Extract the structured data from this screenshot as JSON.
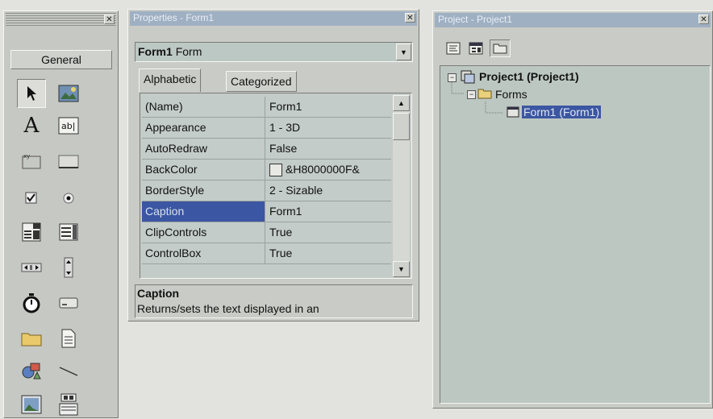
{
  "toolbox": {
    "title": "",
    "tab_label": "General",
    "tools": [
      {
        "icon": "pointer-icon"
      },
      {
        "icon": "picturebox-icon"
      },
      {
        "icon": "label-icon"
      },
      {
        "icon": "textbox-icon"
      },
      {
        "icon": "frame-icon"
      },
      {
        "icon": "commandbutton-icon"
      },
      {
        "icon": "checkbox-icon"
      },
      {
        "icon": "optionbutton-icon"
      },
      {
        "icon": "combobox-icon"
      },
      {
        "icon": "listbox-icon"
      },
      {
        "icon": "hscrollbar-icon"
      },
      {
        "icon": "vscrollbar-icon"
      },
      {
        "icon": "timer-icon"
      },
      {
        "icon": "drivelistbox-icon"
      },
      {
        "icon": "dirlistbox-icon"
      },
      {
        "icon": "filelistbox-icon"
      },
      {
        "icon": "shape-icon"
      },
      {
        "icon": "line-icon"
      },
      {
        "icon": "image-icon"
      },
      {
        "icon": "data-icon"
      }
    ]
  },
  "properties": {
    "title": "Properties - Form1",
    "object_name": "Form1",
    "object_type": "Form",
    "tabs": [
      {
        "label": "Alphabetic",
        "active": true
      },
      {
        "label": "Categorized",
        "active": false
      }
    ],
    "rows": [
      {
        "name": "(Name)",
        "value": "Form1"
      },
      {
        "name": "Appearance",
        "value": "1 - 3D"
      },
      {
        "name": "AutoRedraw",
        "value": "False"
      },
      {
        "name": "BackColor",
        "value": "&H8000000F&"
      },
      {
        "name": "BorderStyle",
        "value": "2 - Sizable"
      },
      {
        "name": "Caption",
        "value": "Form1",
        "selected": true
      },
      {
        "name": "ClipControls",
        "value": "True"
      },
      {
        "name": "ControlBox",
        "value": "True"
      }
    ],
    "description": {
      "title": "Caption",
      "text": "Returns/sets the text displayed in an"
    }
  },
  "project": {
    "title": "Project - Project1",
    "toolbar": [
      {
        "icon": "view-code-icon"
      },
      {
        "icon": "view-object-icon"
      },
      {
        "icon": "toggle-folders-icon"
      }
    ],
    "tree": {
      "root": "Project1 (Project1)",
      "folder": "Forms",
      "item": "Form1 (Form1)"
    }
  },
  "colors": {
    "titlebar": "#9fb0c3",
    "selection": "#3b56a2",
    "grid_bg": "#c3ccc8",
    "tree_bg": "#bcc7c2"
  }
}
